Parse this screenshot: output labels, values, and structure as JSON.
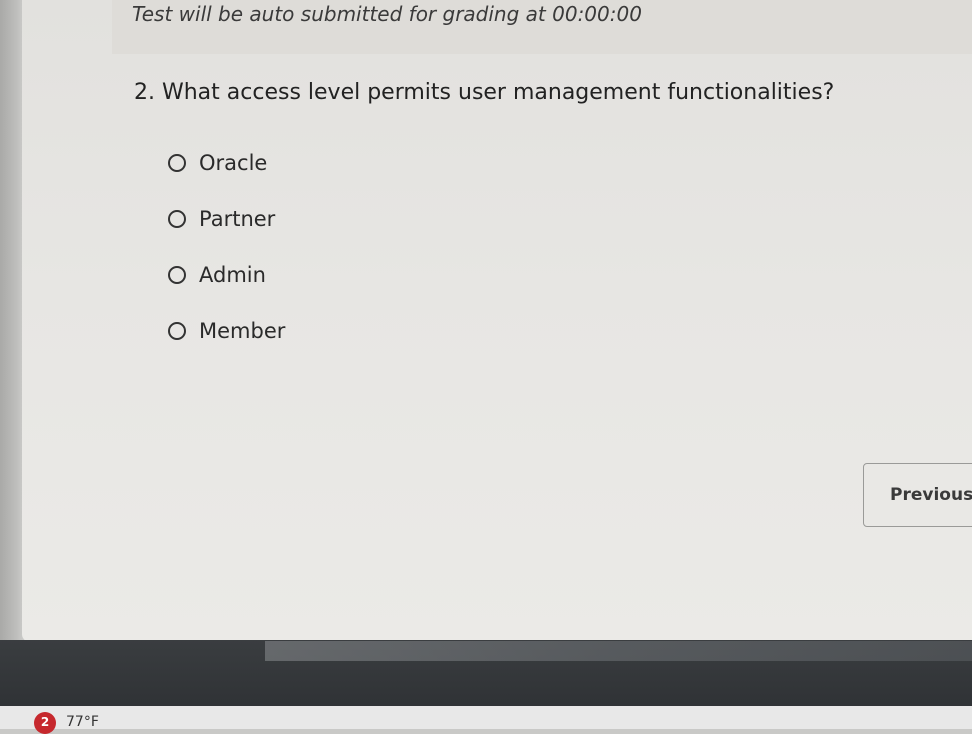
{
  "banner": {
    "text": "Test will be auto submitted for grading at 00:00:00"
  },
  "question": {
    "text": "2. What access level permits user management functionalities?",
    "options": [
      {
        "label": "Oracle"
      },
      {
        "label": "Partner"
      },
      {
        "label": "Admin"
      },
      {
        "label": "Member"
      }
    ]
  },
  "navigation": {
    "previous_label": "Previous"
  },
  "taskbar": {
    "weather_badge": "2",
    "weather_temp": "77°F",
    "badge_color": "#c6282d"
  }
}
